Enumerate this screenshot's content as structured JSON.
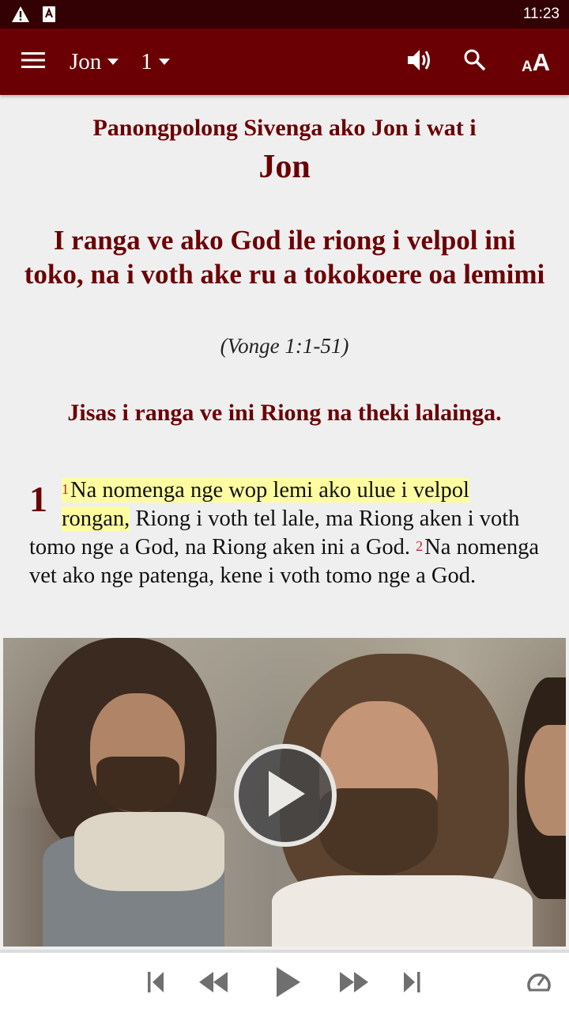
{
  "status_bar": {
    "icons": [
      "warning-icon",
      "font-app-notification-icon"
    ],
    "time": "11:23"
  },
  "app_bar": {
    "menu_icon": "hamburger-menu-icon",
    "book": "Jon",
    "chapter": "1",
    "actions": [
      "speaker-audio-icon",
      "search-icon",
      "text-size-icon"
    ],
    "text_size_small": "A",
    "text_size_large": "A",
    "colors": {
      "app_bar": "#6b0004",
      "status_bar": "#330004"
    }
  },
  "content": {
    "book_intro": "Panongpolong Sivenga ako Jon i wat i",
    "book_title": "Jon",
    "section_title": "I ranga ve ako God ile riong i velpol ini toko, na i voth ake ru a tokokoere oa lemimi",
    "section_ref": "(Vonge 1:1-51)",
    "subsection_title": "Jisas i ranga ve ini Riong na theki lalainga.",
    "chapter_number": "1",
    "verses": [
      {
        "number": "1",
        "highlighted": "Na nomenga nge wop lemi ako ulue i velpol rongan,",
        "text": " Riong i voth tel lale, ma Riong aken i voth tomo nge a God, na Riong aken ini a God."
      },
      {
        "number": "2",
        "text": "Na nomenga vet ako nge patenga, kene i voth tomo nge a God."
      }
    ],
    "colors": {
      "heading": "#6b0004",
      "verse_number": "#c0292b",
      "highlight": "#fefca0"
    }
  },
  "video": {
    "thumbnail": "video-thumbnail-image",
    "play_icon": "play-circle-icon"
  },
  "player": {
    "buttons": [
      "skip-previous-icon",
      "rewind-icon",
      "play-icon",
      "fast-forward-icon",
      "skip-next-icon",
      "playback-speed-icon"
    ]
  }
}
